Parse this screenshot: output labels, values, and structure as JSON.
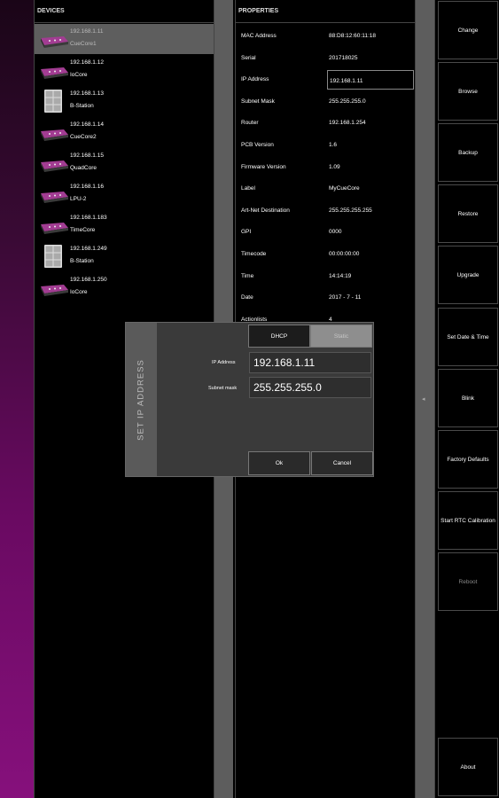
{
  "devices": {
    "header": "DEVICES",
    "items": [
      {
        "ip": "192.168.1.11",
        "name": "CueCore1",
        "kind": "cuecore-icon",
        "selected": true
      },
      {
        "ip": "192.168.1.12",
        "name": "IoCore",
        "kind": "cuecore-icon"
      },
      {
        "ip": "192.168.1.13",
        "name": "B-Station",
        "kind": "bstation-icon"
      },
      {
        "ip": "192.168.1.14",
        "name": "CueCore2",
        "kind": "cuecore-icon"
      },
      {
        "ip": "192.168.1.15",
        "name": "QuadCore",
        "kind": "cuecore-icon"
      },
      {
        "ip": "192.168.1.16",
        "name": "LPU-2",
        "kind": "lpu-icon"
      },
      {
        "ip": "192.168.1.183",
        "name": "TimeCore",
        "kind": "timecore-icon"
      },
      {
        "ip": "192.168.1.249",
        "name": "B-Station",
        "kind": "bstation-icon"
      },
      {
        "ip": "192.168.1.250",
        "name": "IoCore",
        "kind": "cuecore-icon"
      }
    ]
  },
  "properties": {
    "header": "PROPERTIES",
    "rows": [
      {
        "key": "MAC Address",
        "value": "88:D8:12:60:11:18"
      },
      {
        "key": "Serial",
        "value": "201718025"
      },
      {
        "key": "IP Address",
        "value": "192.168.1.11",
        "boxed": true
      },
      {
        "key": "Subnet Mask",
        "value": "255.255.255.0"
      },
      {
        "key": "Router",
        "value": "192.168.1.254"
      },
      {
        "key": "PCB Version",
        "value": "1.6"
      },
      {
        "key": "Firmware Version",
        "value": "1.09"
      },
      {
        "key": "Label",
        "value": "MyCueCore"
      },
      {
        "key": "Art-Net Destination",
        "value": "255.255.255.255"
      },
      {
        "key": "GPI",
        "value": "0000"
      },
      {
        "key": "Timecode",
        "value": "00:00:00:00"
      },
      {
        "key": "Time",
        "value": "14:14:19"
      },
      {
        "key": "Date",
        "value": "2017 - 7 - 11"
      },
      {
        "key": "Actionlists",
        "value": "4"
      }
    ]
  },
  "actions": [
    {
      "label": "Change"
    },
    {
      "label": "Browse"
    },
    {
      "label": "Backup"
    },
    {
      "label": "Restore"
    },
    {
      "label": "Upgrade"
    },
    {
      "label": "Set Date & Time"
    },
    {
      "label": "Blink"
    },
    {
      "label": "Factory Defaults"
    },
    {
      "label": "Start RTC Calibration"
    },
    {
      "label": "Reboot",
      "disabled": true
    },
    {
      "label": "About"
    }
  ],
  "dialog": {
    "title": "SET IP ADDRESS",
    "mode_dhcp": "DHCP",
    "mode_static": "Static",
    "ip_label": "IP Address",
    "ip_value": "192.168.1.11",
    "mask_label": "Subnet mask",
    "mask_value": "255.255.255.0",
    "ok_label": "Ok",
    "cancel_label": "Cancel"
  },
  "colors": {
    "device_accent": "#a23c92",
    "background": "#000000",
    "selection": "#5e5e5e"
  }
}
